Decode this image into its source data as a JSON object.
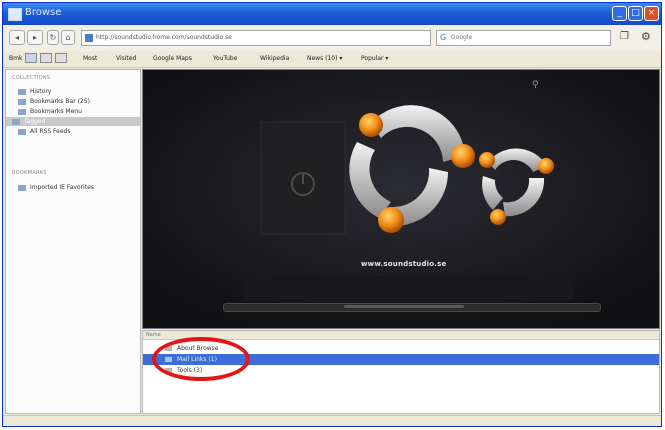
{
  "window": {
    "title": "Browse"
  },
  "toolbar": {
    "back_icon": "back-arrow-icon",
    "forward_icon": "forward-arrow-icon",
    "url": "http://soundstudio.home.com/soundstudio.se",
    "search_placeholder": "Google",
    "bookmark_icon": "bookmark-icon",
    "settings_icon": "gear-icon"
  },
  "bookmarks_bar": {
    "items": [
      "Bmk",
      "Most",
      "Visited",
      "Google Maps",
      "YouTube",
      "Wikipedia",
      "News (10) ▾",
      "Popular ▾"
    ]
  },
  "sidebar": {
    "collections_header": "COLLECTIONS",
    "items": [
      "History",
      "Bookmarks Bar (25)",
      "Bookmarks Menu",
      "Tagged",
      "All RSS Feeds"
    ],
    "selected_index": 3,
    "bookmarks_header": "BOOKMARKS",
    "bookmark_items": [
      "Imported IE Favorites"
    ]
  },
  "main": {
    "cover_label": "www.soundstudio.se"
  },
  "list": {
    "header": "Name",
    "rows": [
      "About Browse",
      "Mail Links (1)",
      "Tools (3)"
    ],
    "selected_index": 1
  },
  "status": {
    "text": ""
  },
  "colors": {
    "titlebar": "#1c5fd5",
    "selection": "#3d6dd8",
    "annotation": "#e21616",
    "coverflow_bg": "#121213",
    "orb": "#f28f1a"
  }
}
